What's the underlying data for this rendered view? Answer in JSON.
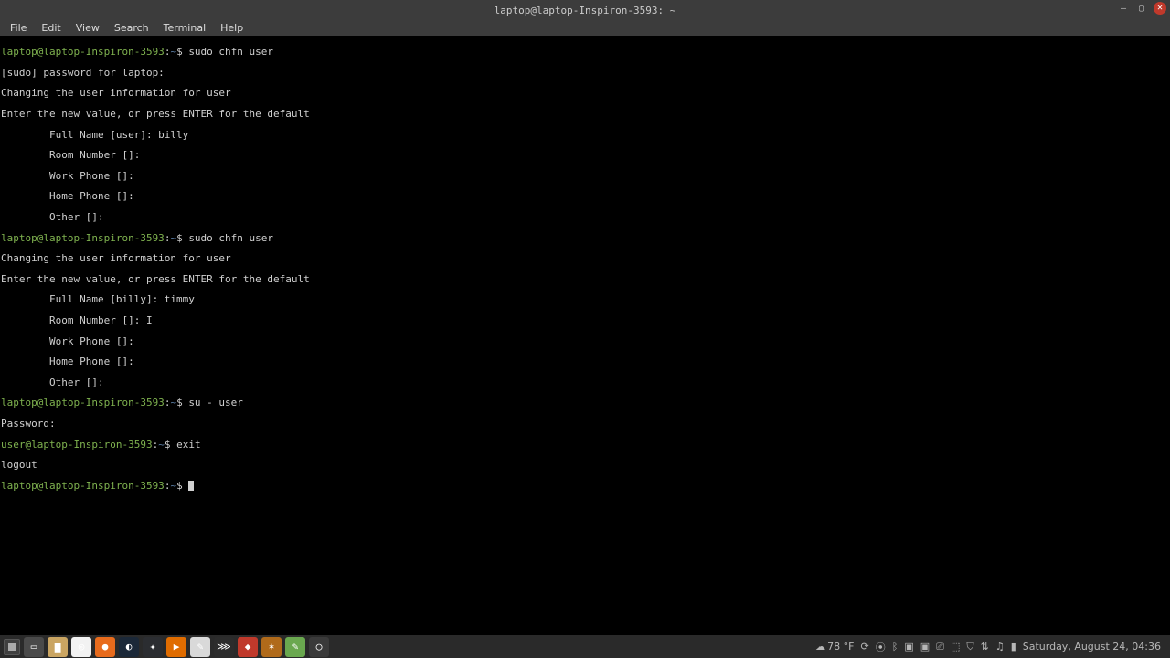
{
  "titlebar": {
    "title": "laptop@laptop-Inspiron-3593: ~"
  },
  "menubar": {
    "items": [
      "File",
      "Edit",
      "View",
      "Search",
      "Terminal",
      "Help"
    ]
  },
  "prompt1": {
    "userhost": "laptop@laptop-Inspiron-3593",
    "sep": ":",
    "path": "~",
    "dollar": "$ "
  },
  "prompt_user": {
    "userhost": "user@laptop-Inspiron-3593",
    "sep": ":",
    "path": "~",
    "dollar": "$ "
  },
  "lines": {
    "cmd1": "sudo chfn user",
    "sudo_pw": "[sudo] password for laptop: ",
    "chg1": "Changing the user information for user",
    "enter1": "Enter the new value, or press ENTER for the default",
    "full1": "        Full Name [user]: billy",
    "room1": "        Room Number []: ",
    "workp1": "        Work Phone []: ",
    "homep1": "        Home Phone []: ",
    "other1": "        Other []: ",
    "cmd2": "sudo chfn user",
    "chg2": "Changing the user information for user",
    "enter2": "Enter the new value, or press ENTER for the default",
    "full2": "        Full Name [billy]: timmy",
    "room2_pre": "        Room Number []: ",
    "workp2": "        Work Phone []: ",
    "homep2": "        Home Phone []: ",
    "other2": "        Other []: ",
    "cmd3": "su - user",
    "pw": "Password: ",
    "cmd4": "exit",
    "logout": "logout"
  },
  "taskbar": {
    "apps": [
      {
        "name": "show-desktop",
        "bg": "#4a4a4a",
        "glyph": "▭"
      },
      {
        "name": "files",
        "bg": "#caa562",
        "glyph": "▆"
      },
      {
        "name": "chrome",
        "bg": "#f2f2f2",
        "glyph": "◎"
      },
      {
        "name": "firefox",
        "bg": "#e86b1c",
        "glyph": "●"
      },
      {
        "name": "steam",
        "bg": "#1b2838",
        "glyph": "◐"
      },
      {
        "name": "discord",
        "bg": "#2b2d31",
        "glyph": "✦"
      },
      {
        "name": "media-player",
        "bg": "#e06c00",
        "glyph": "▶"
      },
      {
        "name": "gimp",
        "bg": "#d9d9d9",
        "glyph": "✎"
      },
      {
        "name": "app-dark",
        "bg": "#2c2c2c",
        "glyph": "⋙"
      },
      {
        "name": "app-red",
        "bg": "#c0392b",
        "glyph": "◆"
      },
      {
        "name": "app-orange",
        "bg": "#b06a1a",
        "glyph": "✶"
      },
      {
        "name": "app-green",
        "bg": "#6aa84f",
        "glyph": "✎"
      },
      {
        "name": "mint-menu",
        "bg": "#3a3a3a",
        "glyph": "◯"
      }
    ],
    "temperature": "78 °F",
    "clock": "Saturday, August 24, 04:36"
  }
}
